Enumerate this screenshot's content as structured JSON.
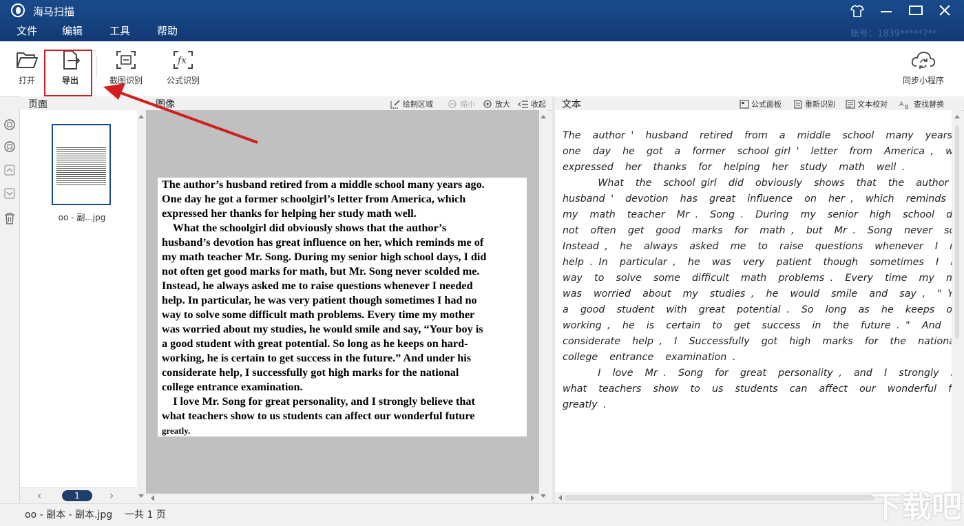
{
  "app": {
    "title": "海马扫描",
    "account": "账号：1839*****7**"
  },
  "menu": [
    "文件",
    "编辑",
    "工具",
    "帮助"
  ],
  "toolbar": {
    "open": "打开",
    "export": "导出",
    "screenshot_ocr": "截图识别",
    "formula_ocr": "公式识别",
    "sync": "同步小程序"
  },
  "panels": {
    "pages_title": "页面",
    "image_title": "图像",
    "text_title": "文本"
  },
  "image_tools": {
    "draw_area": "绘制区域",
    "zoom_out": "缩小",
    "zoom_in": "放大",
    "collapse": "收起"
  },
  "text_tools": {
    "formula_panel": "公式面板",
    "re_recognize": "重新识别",
    "proofread": "文本校对",
    "find_replace": "查找替换"
  },
  "thumbnail": {
    "name": "oo - 副...jpg"
  },
  "pager": {
    "prev": "‹",
    "current": "1",
    "next": "›"
  },
  "document_image_lines": [
    "The author’s husband retired from a middle school many years ago.",
    "One day he got a former schoolgirl’s letter from America, which",
    "expressed her thanks for helping her study math well.",
    "    What the schoolgirl did obviously shows that the author’s",
    "husband’s devotion has great influence on her, which reminds me of",
    "my math teacher Mr. Song. During my senior high school days, I did",
    "not often get good marks for math, but Mr. Song never scolded me.",
    "Instead, he always asked me to raise questions whenever I needed",
    "help. In particular, he was very patient though sometimes I had no",
    "way to solve some difficult math problems. Every time my mother",
    "was worried about my studies, he would smile and say, “Your boy is",
    "a good student with great potential. So long as he keeps on hard-",
    "working, he is certain to get success in the future.” And under his",
    "considerate help, I successfully got high marks for the national",
    "college entrance examination.",
    "    I love Mr. Song for great personality, and I strongly believe that",
    "what teachers show to us students can affect our wonderful future",
    "greatly."
  ],
  "recognized_text_lines": [
    "The  author '  husband  retired  from  a  middle  school  many  years  ago .",
    "one  day  he  got  a  former  school girl '  letter  from  America ,  which",
    "expressed  her  thanks  for  helping  her  study  math  well .",
    "      What  the  school girl  did  obviously  shows  that  the  author '",
    "husband '  devotion  has  great  influence  on  her ,  which  reminds  me  of",
    "my  math  teacher  Mr .  Song .  During  my  senior  high  school  days ,  I",
    "not  often  get  good  marks  for  math ,  but  Mr .  Song  never  scolded  me",
    "Instead ,  he  always  asked  me  to  raise  questions  whenever  I  needed",
    "help . In  particular ,  he  was  very  patient  though  sometimes  I  had  no",
    "way  to  solve  some  difficult  math  problems .  Every  time  my  mother",
    "was  worried  about  my  studies ,  he  would  smile  and  say ,  \" Your  boy",
    "a  good  student  with  great  potential .  So  long  as  he  keeps  on  hard -",
    "working ,  he  is  certain  to  get  success  in  the  future . \"  And  under  his",
    "considerate  help ,  I  Successfully  got  high  marks  for  the  national",
    "college  entrance  examination .",
    "      I  love  Mr .  Song  for  great  personality ,  and  I  strongly  believe  tha",
    "what  teachers  show  to  us  students  can  affect  our  wonderful  future",
    "greatly ."
  ],
  "status": {
    "filename": "oo - 副本 - 副本.jpg",
    "page_count": "一共 1 页"
  },
  "watermark": "下载吧",
  "colors": {
    "title_bar": "#1a4a8c",
    "highlight": "#d21e1e",
    "pager_badge": "#1f3e6a"
  }
}
